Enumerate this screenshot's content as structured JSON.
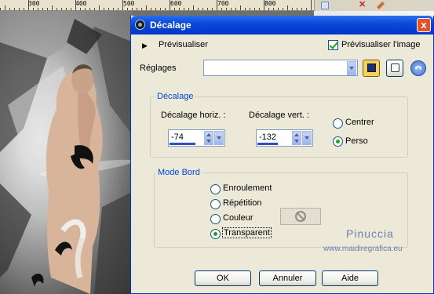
{
  "window": {
    "title": "Décalage",
    "close_symbol": "x"
  },
  "ruler": {
    "ticks": [
      "300",
      "400",
      "500",
      "600",
      "700",
      "800"
    ]
  },
  "preview": {
    "label": "Prévisualiser",
    "image_preview_label": "Prévisualiser l'image",
    "image_preview_checked": true
  },
  "presets": {
    "label": "Réglages",
    "value": ""
  },
  "offset_group": {
    "title": "Décalage",
    "horizontal_label": "Décalage horiz. :",
    "horizontal_value": "-74",
    "vertical_label": "Décalage vert. :",
    "vertical_value": "-132",
    "center_label": "Centrer",
    "custom_label": "Perso",
    "selected": "custom"
  },
  "edge_group": {
    "title": "Mode Bord",
    "options": [
      "Enroulement",
      "Répétition",
      "Couleur",
      "Transparent"
    ],
    "selected": "Transparent"
  },
  "buttons": {
    "ok": "OK",
    "cancel": "Annuler",
    "help": "Aide"
  },
  "watermark": {
    "name": "Pinuccia",
    "url": "www.maidiregrafica.eu"
  },
  "icons": {
    "title": "dialog-app-icon",
    "save": "save-icon",
    "random": "dice-icon",
    "reset": "reset-icon",
    "no_color": "no-color-icon"
  },
  "colors": {
    "titlebar": "#0a4ad8",
    "dialog_bg": "#ece9d8",
    "group_title": "#0046d5",
    "check_mark": "#21a121"
  }
}
